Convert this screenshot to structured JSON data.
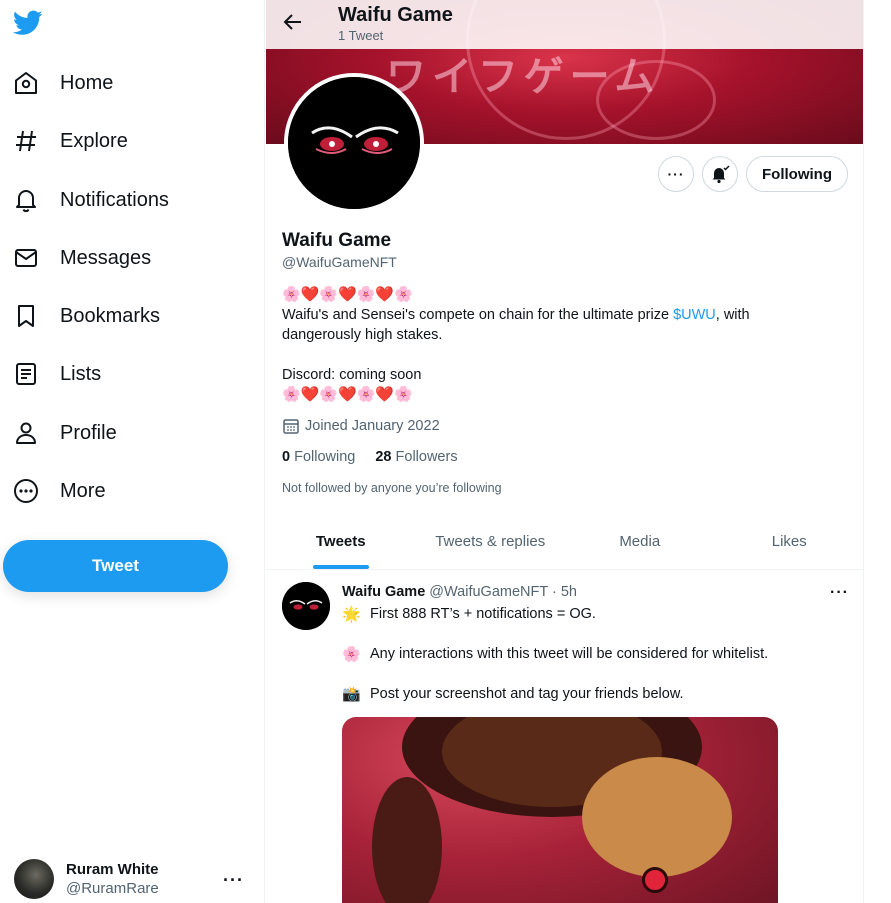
{
  "nav": {
    "items": [
      {
        "label": "Home",
        "icon": "home-icon"
      },
      {
        "label": "Explore",
        "icon": "hashtag-icon"
      },
      {
        "label": "Notifications",
        "icon": "bell-icon"
      },
      {
        "label": "Messages",
        "icon": "envelope-icon"
      },
      {
        "label": "Bookmarks",
        "icon": "bookmark-icon"
      },
      {
        "label": "Lists",
        "icon": "list-icon"
      },
      {
        "label": "Profile",
        "icon": "person-icon"
      },
      {
        "label": "More",
        "icon": "more-circle-icon"
      }
    ],
    "tweet_button": "Tweet"
  },
  "account": {
    "name": "Ruram White",
    "handle": "@RuramRare"
  },
  "header": {
    "title": "Waifu Game",
    "subtitle": "1 Tweet"
  },
  "banner": {
    "text": "ワイフゲーム"
  },
  "profile": {
    "name": "Waifu Game",
    "handle": "@WaifuGameNFT",
    "following_button": "Following",
    "bio_emojis": "🌸❤️🌸❤️🌸❤️🌸",
    "bio_line_1_prefix": "Waifu's and Sensei's compete on chain for the ultimate prize ",
    "bio_link": "$UWU",
    "bio_line_1_suffix": ", with",
    "bio_line_2": "dangerously high stakes.",
    "bio_line_3": "Discord: coming soon",
    "bio_emojis_2": "🌸❤️🌸❤️🌸❤️🌸",
    "joined": "Joined January 2022",
    "following_count": "0",
    "following_label": "Following",
    "followers_count": "28",
    "followers_label": "Followers",
    "not_followed": "Not followed by anyone you’re following"
  },
  "tabs": [
    "Tweets",
    "Tweets & replies",
    "Media",
    "Likes"
  ],
  "tweet": {
    "name": "Waifu Game",
    "meta": "@WaifuGameNFT · 5h",
    "lines": [
      {
        "emoji": "🌟",
        "text": "First 888 RT’s + notifications = OG."
      },
      {
        "emoji": "🌸",
        "text": "Any interactions with this tweet will be considered for whitelist."
      },
      {
        "emoji": "📸",
        "text": "Post your screenshot and tag your friends below."
      }
    ]
  },
  "colors": {
    "accent": "#1d9bf0",
    "text": "#0f1419",
    "muted": "#536471",
    "banner": "#a5122b"
  }
}
